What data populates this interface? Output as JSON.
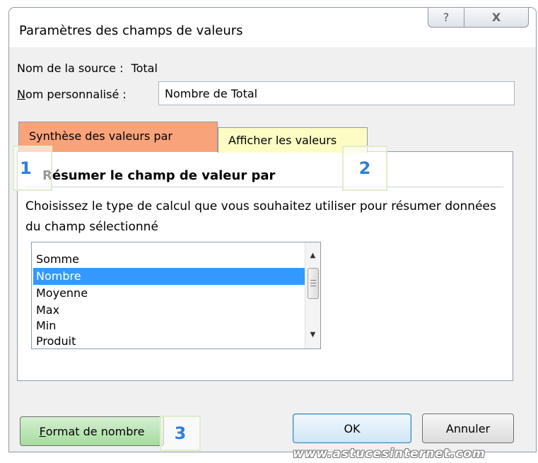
{
  "dialog": {
    "title": "Paramètres des champs de valeurs",
    "help_glyph": "?",
    "close_glyph": "X"
  },
  "source": {
    "label": "Nom de la source :",
    "value": "Total"
  },
  "custom_name": {
    "label_first": "N",
    "label_rest": "om personnalisé :",
    "value": "Nombre de Total"
  },
  "tabs": [
    {
      "label": "Synthèse des valeurs par",
      "active": true
    },
    {
      "label": "Afficher les valeurs",
      "active": false
    }
  ],
  "callouts": [
    "1",
    "2",
    "3"
  ],
  "summary": {
    "section_title": "Résumer le champ de valeur par",
    "description": "Choisissez le type de calcul que vous souhaitez utiliser pour résumer données du champ sélectionné",
    "items": [
      "Somme",
      "Nombre",
      "Moyenne",
      "Max",
      "Min",
      "Produit"
    ],
    "selected": "Nombre"
  },
  "buttons": {
    "format_first": "F",
    "format_rest": "ormat de nombre",
    "ok": "OK",
    "cancel": "Annuler"
  },
  "watermark": "www.astucesinternet.com",
  "colors": {
    "active_tab": "#f9a37a",
    "second_tab": "#fdfcc4",
    "callout_text": "#2f7de0",
    "selection": "#3399ff",
    "format_button": "#a7dba0"
  }
}
